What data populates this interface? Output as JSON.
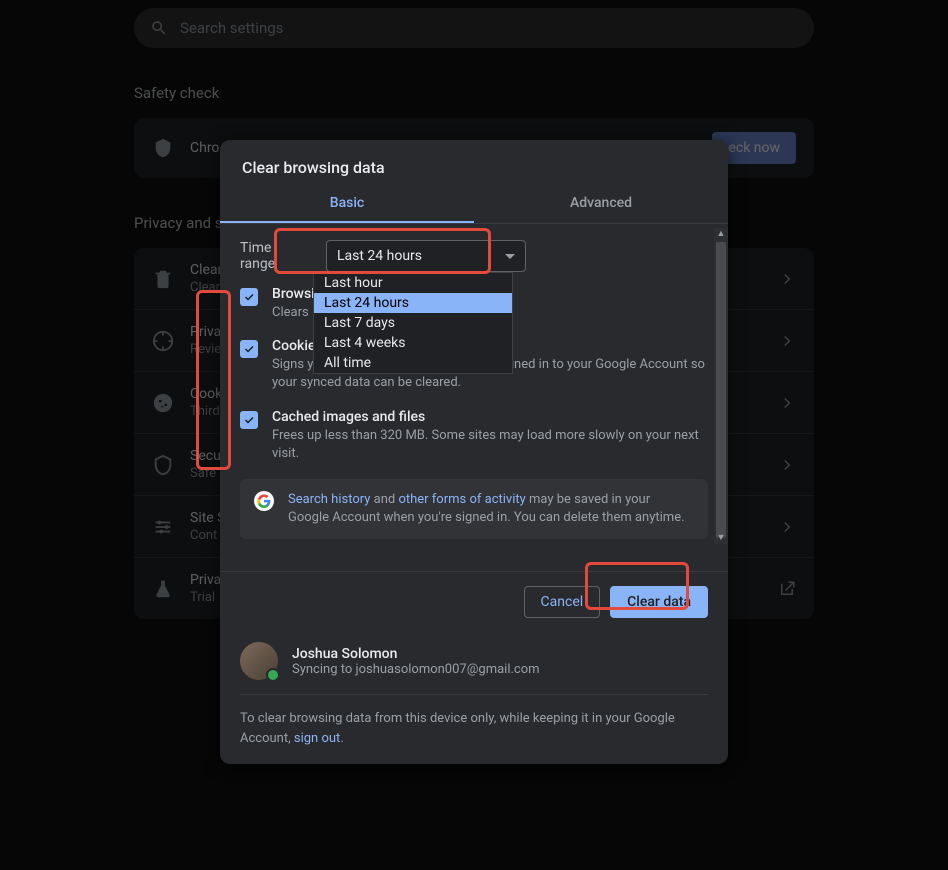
{
  "search": {
    "placeholder": "Search settings"
  },
  "sections": {
    "safety_check": "Safety check",
    "privacy_security": "Privacy and s"
  },
  "safety_row": {
    "title": "Chro",
    "button": "eck now"
  },
  "privacy_rows": [
    {
      "title": "Clear",
      "sub": "Clear",
      "icon": "trash"
    },
    {
      "title": "Priva",
      "sub": "Revie",
      "icon": "compass"
    },
    {
      "title": "Cook",
      "sub": "Third",
      "icon": "cookie"
    },
    {
      "title": "Secu",
      "sub": "Safe",
      "icon": "shield"
    },
    {
      "title": "Site S",
      "sub": "Cont",
      "icon": "sliders"
    },
    {
      "title": "Priva",
      "sub": "Trial",
      "icon": "flask"
    }
  ],
  "modal": {
    "title": "Clear browsing data",
    "tabs": {
      "basic": "Basic",
      "advanced": "Advanced"
    },
    "time_range_label": "Time range",
    "time_range_selected": "Last 24 hours",
    "time_range_options": [
      "Last hour",
      "Last 24 hours",
      "Last 7 days",
      "Last 4 weeks",
      "All time"
    ],
    "items": [
      {
        "title": "Browsi",
        "sub": "Clears"
      },
      {
        "title": "Cookies and other site data",
        "sub": "Signs you out of most sites. You'll stay signed in to your Google Account so your synced data can be cleared."
      },
      {
        "title": "Cached images and files",
        "sub": "Frees up less than 320 MB. Some sites may load more slowly on your next visit."
      }
    ],
    "info": {
      "link1": "Search history",
      "mid": " and ",
      "link2": "other forms of activity",
      "rest": " may be saved in your Google Account when you're signed in. You can delete them anytime."
    },
    "buttons": {
      "cancel": "Cancel",
      "clear": "Clear data"
    },
    "profile": {
      "name": "Joshua Solomon",
      "sync": "Syncing to joshuasolomon007@gmail.com"
    },
    "signout_pre": "To clear browsing data from this device only, while keeping it in your Google Account, ",
    "signout_link": "sign out",
    "signout_post": "."
  }
}
